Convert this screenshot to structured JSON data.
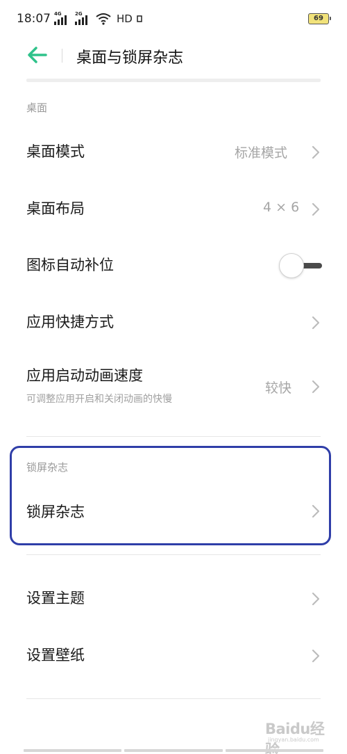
{
  "status_bar": {
    "time": "18:07",
    "signal_1_tag": "4G",
    "signal_2_tag": "2G",
    "network_text": "HD",
    "battery": "69"
  },
  "app_bar": {
    "title": "桌面与锁屏杂志",
    "back_icon": "back-arrow-icon",
    "accent_color": "#2fc28a"
  },
  "sections": {
    "desktop": {
      "header": "桌面",
      "items": [
        {
          "title": "桌面模式",
          "value": "标准模式"
        },
        {
          "title": "桌面布局",
          "value": "4 × 6"
        },
        {
          "title": "图标自动补位",
          "toggle": false
        },
        {
          "title": "应用快捷方式"
        },
        {
          "title": "应用启动动画速度",
          "subtitle": "可调整应用开启和关闭动画的快慢",
          "value": "较快"
        }
      ]
    },
    "lockscreen": {
      "header": "锁屏杂志",
      "items": [
        {
          "title": "锁屏杂志"
        }
      ],
      "highlight_color": "#2f3ea8"
    },
    "theme": {
      "items": [
        {
          "title": "设置主题"
        },
        {
          "title": "设置壁纸"
        }
      ]
    }
  },
  "watermark": {
    "brand": "Baidu经验",
    "url": "jingyan.baidu.com"
  }
}
